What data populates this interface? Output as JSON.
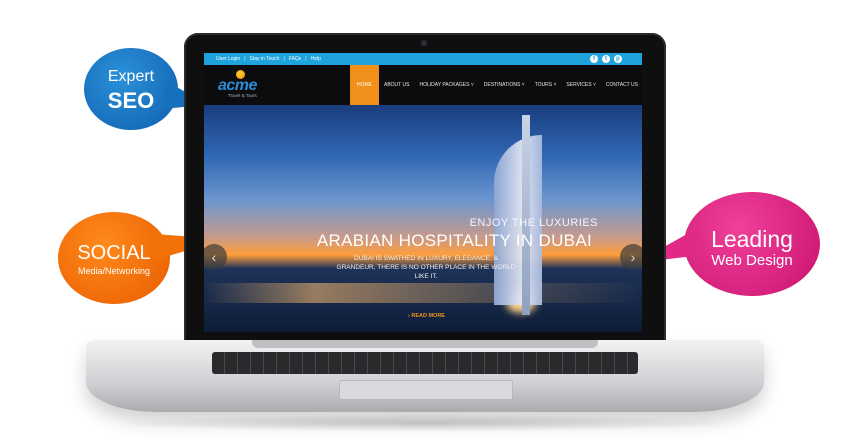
{
  "topbar": {
    "links": [
      "User Login",
      "Stay in Touch",
      "FAQs",
      "Help"
    ],
    "social_icons": [
      "facebook-icon",
      "twitter-icon",
      "pinterest-icon"
    ]
  },
  "logo": {
    "text": "acme",
    "subtitle": "Travel & Tours"
  },
  "nav": {
    "items": [
      "HOME",
      "ABOUT US",
      "HOLIDAY PACKAGES ˅",
      "DESTINATIONS ˅",
      "TOURS ˅",
      "SERVICES ˅",
      "CONTACT US"
    ],
    "active_index": 0
  },
  "hero": {
    "subtitle": "ENJOY THE LUXURIES",
    "title": "ARABIAN HOSPITALITY IN DUBAI",
    "description": "DUBAI IS SWATHED IN LUXURY, ELEGANCE, & GRANDEUR, THERE IS NO OTHER PLACE IN THE WORLD LIKE IT.",
    "read_more": "› READ MORE",
    "prev_symbol": "‹",
    "next_symbol": "›"
  },
  "bubbles": {
    "seo": {
      "line1": "Expert",
      "line2": "SEO",
      "color": "#1570bd"
    },
    "social": {
      "line1": "SOCIAL",
      "line2": "Media/Networking",
      "color": "#f27208"
    },
    "design": {
      "line1": "Leading",
      "line2": "Web Design",
      "color": "#e02a86"
    }
  },
  "colors": {
    "accent_orange": "#f0901a",
    "topbar_blue": "#1fa3dc",
    "nav_bg": "#0c0c0e"
  }
}
